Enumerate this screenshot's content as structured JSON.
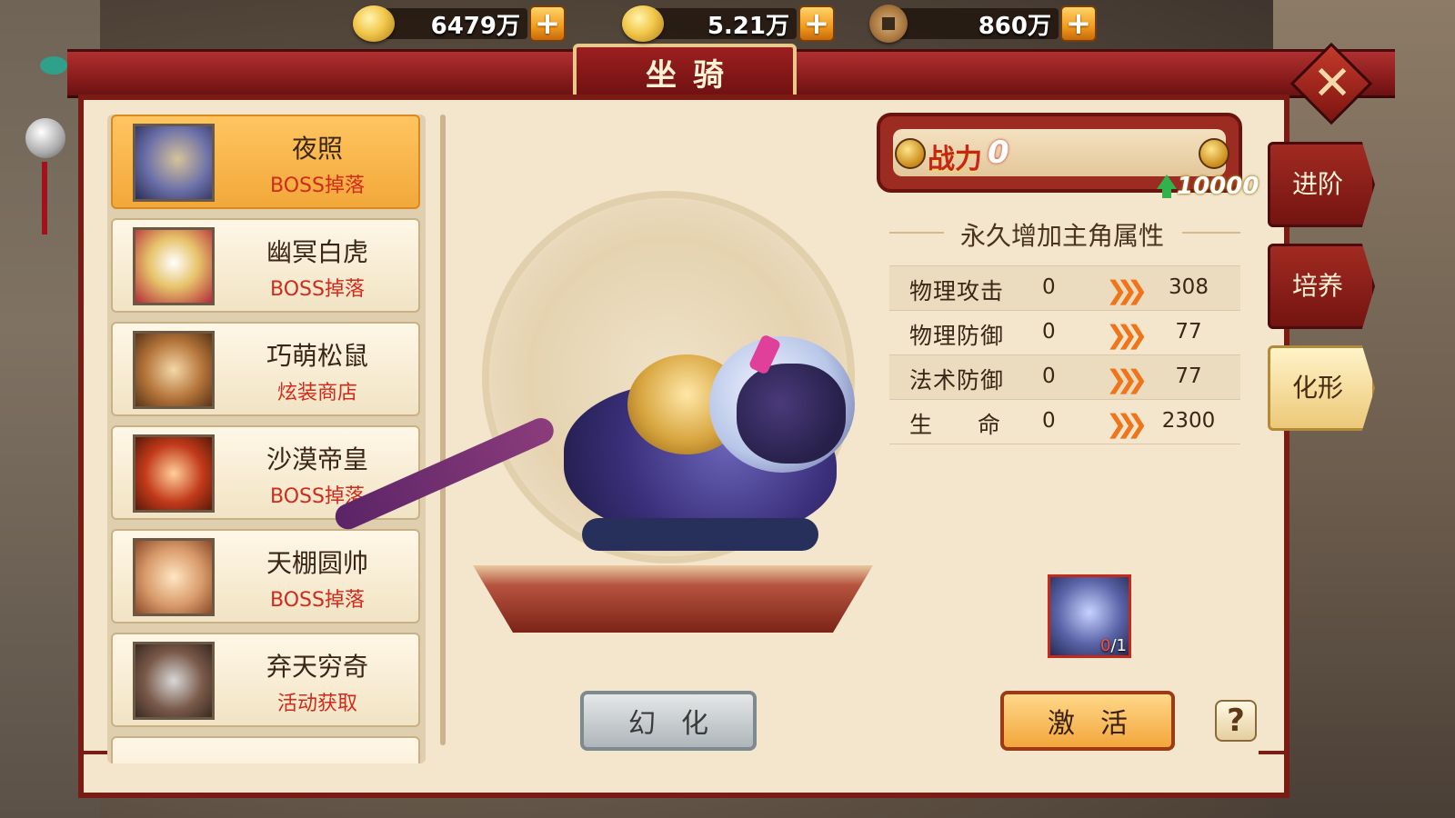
{
  "currency": {
    "gold": "6479万",
    "silver": "5.21万",
    "coin": "860万",
    "plus": "+"
  },
  "header": {
    "title": "坐骑",
    "close": "✕"
  },
  "mounts": [
    {
      "name": "夜照",
      "source": "BOSS掉落",
      "selected": true
    },
    {
      "name": "幽冥白虎",
      "source": "BOSS掉落",
      "selected": false
    },
    {
      "name": "巧萌松鼠",
      "source": "炫装商店",
      "selected": false
    },
    {
      "name": "沙漠帝皇",
      "source": "BOSS掉落",
      "selected": false
    },
    {
      "name": "天棚圆帅",
      "source": "BOSS掉落",
      "selected": false
    },
    {
      "name": "弃天穷奇",
      "source": "活动获取",
      "selected": false
    }
  ],
  "power": {
    "label": "战力",
    "value": "0",
    "bonus": "10000"
  },
  "attributes": {
    "title": "永久增加主角属性",
    "rows": [
      {
        "name": "物理攻击",
        "current": "0",
        "next": "308"
      },
      {
        "name": "物理防御",
        "current": "0",
        "next": "77"
      },
      {
        "name": "法术防御",
        "current": "0",
        "next": "77"
      },
      {
        "name": "生命",
        "current": "0",
        "next": "2300"
      }
    ]
  },
  "tabs": [
    {
      "label": "进阶",
      "active": false
    },
    {
      "label": "培养",
      "active": false
    },
    {
      "label": "化形",
      "active": true
    }
  ],
  "item": {
    "have": "0",
    "need": "/1"
  },
  "buttons": {
    "transform": "幻化",
    "activate": "激活",
    "help": "?"
  },
  "colors": {
    "frame_red": "#7a1c14",
    "selected_orange": "#f2a83a",
    "source_red": "#d22a1a",
    "arrow_orange": "#f0741a"
  }
}
